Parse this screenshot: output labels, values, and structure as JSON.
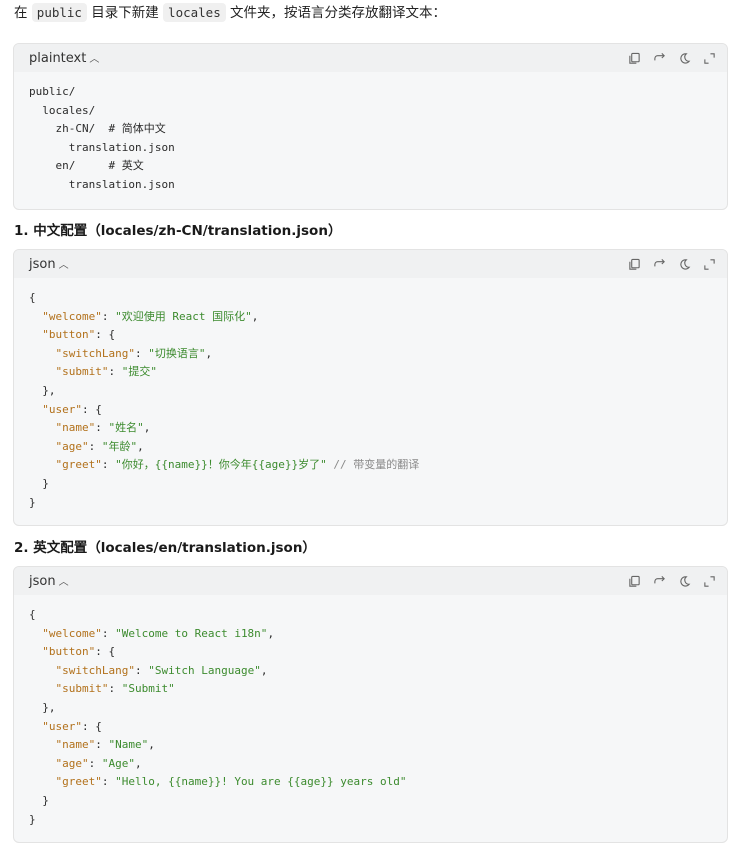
{
  "intro": {
    "pre": "在",
    "code1": "public",
    "mid": "目录下新建",
    "code2": "locales",
    "post": "文件夹，按语言分类存放翻译文本："
  },
  "blocks": [
    {
      "lang": "plaintext",
      "lines": [
        "public/",
        "  locales/",
        "    zh-CN/  # 简体中文",
        "      translation.json",
        "    en/     # 英文",
        "      translation.json"
      ]
    },
    {
      "heading": "1. 中文配置（locales/zh-CN/translation.json）",
      "lang": "json",
      "tokens": {
        "welcome": "\"welcome\"",
        "welcome_v": "\"欢迎使用 React 国际化\"",
        "button": "\"button\"",
        "switchLang": "\"switchLang\"",
        "switchLang_v": "\"切换语言\"",
        "submit": "\"submit\"",
        "submit_v": "\"提交\"",
        "user": "\"user\"",
        "name": "\"name\"",
        "name_v": "\"姓名\"",
        "age": "\"age\"",
        "age_v": "\"年龄\"",
        "greet": "\"greet\"",
        "greet_v": "\"你好，{{name}}！你今年{{age}}岁了\"",
        "comment": "// 带变量的翻译"
      }
    },
    {
      "heading": "2. 英文配置（locales/en/translation.json）",
      "lang": "json",
      "tokens": {
        "welcome": "\"welcome\"",
        "welcome_v": "\"Welcome to React i18n\"",
        "button": "\"button\"",
        "switchLang": "\"switchLang\"",
        "switchLang_v": "\"Switch Language\"",
        "submit": "\"submit\"",
        "submit_v": "\"Submit\"",
        "user": "\"user\"",
        "name": "\"name\"",
        "name_v": "\"Name\"",
        "age": "\"age\"",
        "age_v": "\"Age\"",
        "greet": "\"greet\"",
        "greet_v": "\"Hello, {{name}}! You are {{age}} years old\""
      }
    }
  ],
  "colors": {
    "key": "#b2711b",
    "string": "#3c8b2e",
    "comment": "#8a8a8a",
    "block_bg": "#f6f7f8",
    "header_bg": "#f0f1f2"
  },
  "toolbar_icons": [
    "copy-icon",
    "wrap-icon",
    "theme-icon",
    "expand-icon"
  ]
}
